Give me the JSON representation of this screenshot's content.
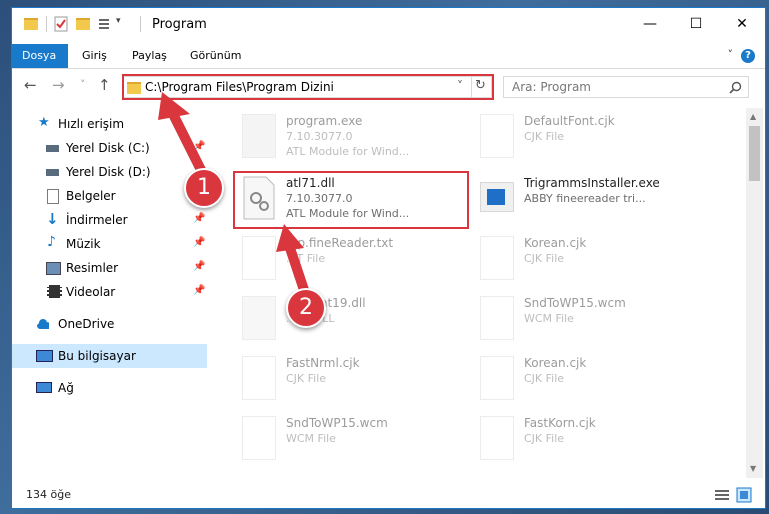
{
  "window": {
    "title": "Program"
  },
  "ribbon": {
    "tabs": [
      {
        "label": "Dosya",
        "active": true
      },
      {
        "label": "Giriş"
      },
      {
        "label": "Paylaş"
      },
      {
        "label": "Görünüm"
      }
    ],
    "help": "?"
  },
  "nav": {
    "back": "←",
    "forward": "→",
    "recent": "˅",
    "up": "↑",
    "address": "C:\\Program Files\\Program Dizini",
    "dropdown": "˅",
    "refresh": "↻",
    "search_placeholder": "Ara: Program"
  },
  "sidebar": {
    "items": [
      {
        "label": "Hızlı erişim",
        "icon": "star-icon"
      },
      {
        "label": "Yerel Disk (C:)",
        "icon": "drive-icon",
        "pinned": true
      },
      {
        "label": "Yerel Disk (D:)",
        "icon": "drive-icon"
      },
      {
        "label": "Belgeler",
        "icon": "documents-icon",
        "pinned": true
      },
      {
        "label": "İndirmeler",
        "icon": "download-icon",
        "pinned": true
      },
      {
        "label": "Müzik",
        "icon": "music-icon",
        "pinned": true
      },
      {
        "label": "Resimler",
        "icon": "pictures-icon",
        "pinned": true
      },
      {
        "label": "Videolar",
        "icon": "video-icon",
        "pinned": true
      },
      {
        "label": "OneDrive",
        "icon": "cloud-icon"
      },
      {
        "label": "Bu bilgisayar",
        "icon": "computer-icon",
        "selected": true
      },
      {
        "label": "Ağ",
        "icon": "network-icon"
      }
    ]
  },
  "files": [
    {
      "name": "program.exe",
      "line1": "7.10.3077.0",
      "line2": "ATL Module for Wind..."
    },
    {
      "name": "DefaultFont.cjk",
      "line1": "CJK File",
      "line2": ""
    },
    {
      "name": "atl71.dll",
      "line1": "7.10.3077.0",
      "line2": "ATL Module for Wind..."
    },
    {
      "name": "TrigrammsInstaller.exe",
      "line1": "ABBY fineereader tri...",
      "line2": ""
    },
    {
      "name": "...p.fineReader.txt",
      "line1": "...T File",
      "line2": ""
    },
    {
      "name": "Korean.cjk",
      "line1": "CJK File",
      "line2": ""
    },
    {
      "name": "...Client19.dll",
      "line1": "...ne DLL",
      "line2": ""
    },
    {
      "name": "SndToWP15.wcm",
      "line1": "WCM File",
      "line2": ""
    },
    {
      "name": "FastNrml.cjk",
      "line1": "CJK File",
      "line2": ""
    },
    {
      "name": "Korean.cjk",
      "line1": "CJK File",
      "line2": ""
    },
    {
      "name": "SndToWP15.wcm",
      "line1": "WCM File",
      "line2": ""
    },
    {
      "name": "FastKorn.cjk",
      "line1": "CJK File",
      "line2": ""
    }
  ],
  "status": {
    "count": "134 öğe"
  },
  "callouts": [
    "1",
    "2"
  ],
  "colors": {
    "accent": "#1979ca",
    "annotation": "#d9363e",
    "selected": "#cce8ff"
  }
}
